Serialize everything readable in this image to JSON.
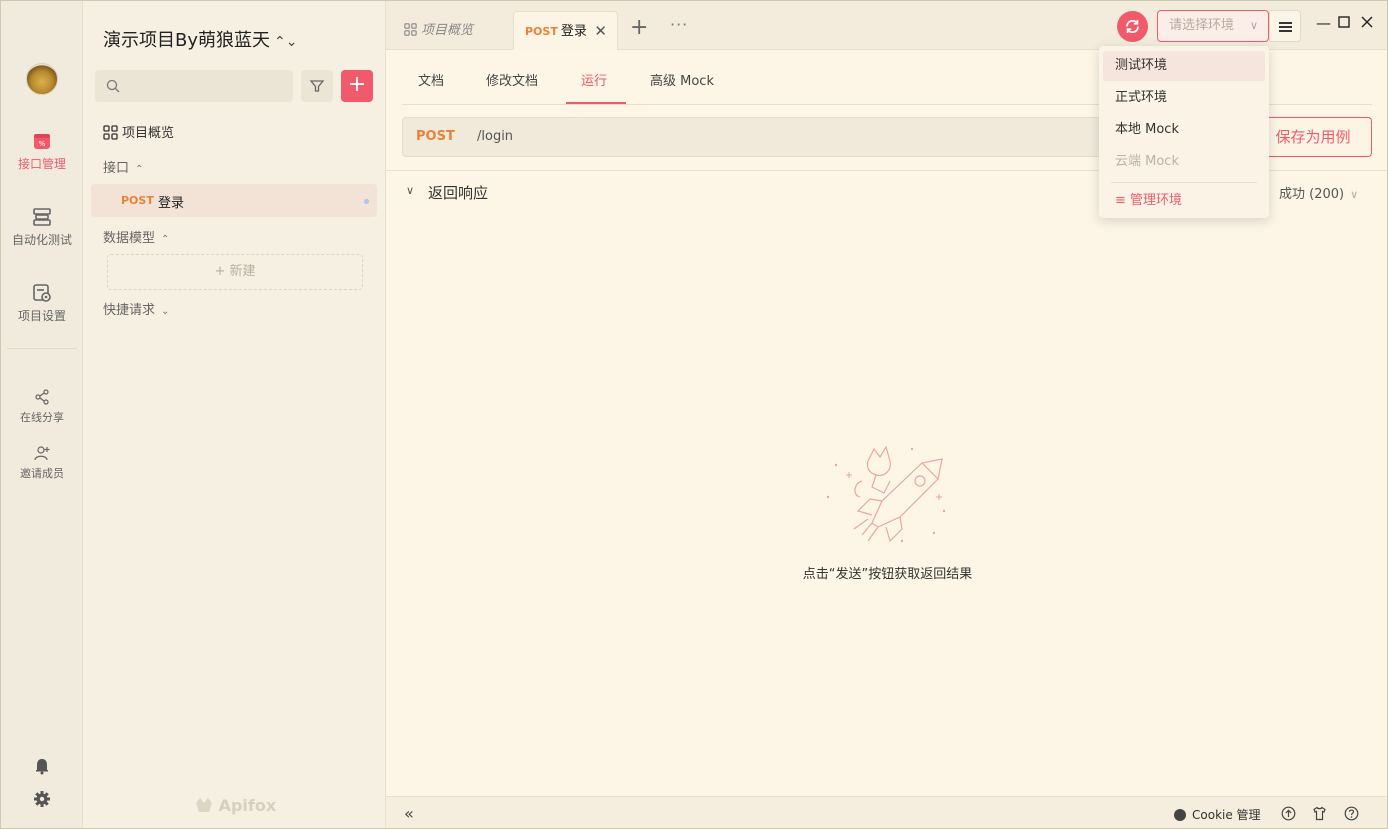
{
  "rail": {
    "items": [
      {
        "label": "接口管理",
        "icon": "api-management-icon",
        "active": true
      },
      {
        "label": "自动化测试",
        "icon": "automation-test-icon",
        "active": false
      },
      {
        "label": "项目设置",
        "icon": "project-settings-icon",
        "active": false
      },
      {
        "label": "在线分享",
        "icon": "share-icon",
        "active": false
      },
      {
        "label": "邀请成员",
        "icon": "invite-member-icon",
        "active": false
      }
    ]
  },
  "sidebar": {
    "project_title": "演示项目By萌狼蓝天",
    "overview_label": "项目概览",
    "api_group_label": "接口",
    "api_items": [
      {
        "method": "POST",
        "name": "登录"
      }
    ],
    "model_group_label": "数据模型",
    "new_label": "+ 新建",
    "quick_request_label": "快捷请求",
    "brand": "Apifox"
  },
  "tabs": {
    "overview_label": "项目概览",
    "active_method": "POST",
    "active_name": "登录"
  },
  "env": {
    "placeholder": "请选择环境",
    "options": [
      "测试环境",
      "正式环境",
      "本地 Mock",
      "云端 Mock"
    ],
    "manage_label": "≡ 管理环境"
  },
  "subtabs": [
    "文档",
    "修改文档",
    "运行",
    "高级 Mock"
  ],
  "request": {
    "method": "POST",
    "path": "/login",
    "save_label": "保存为用例"
  },
  "response": {
    "title": "返回响应",
    "status": "成功 (200)",
    "empty_text": "点击“发送”按钮获取返回结果"
  },
  "statusbar": {
    "cookie_label": "Cookie 管理"
  },
  "colors": {
    "accent": "#f05a6b",
    "method_post": "#e8833a",
    "background": "#fdf6e6"
  }
}
